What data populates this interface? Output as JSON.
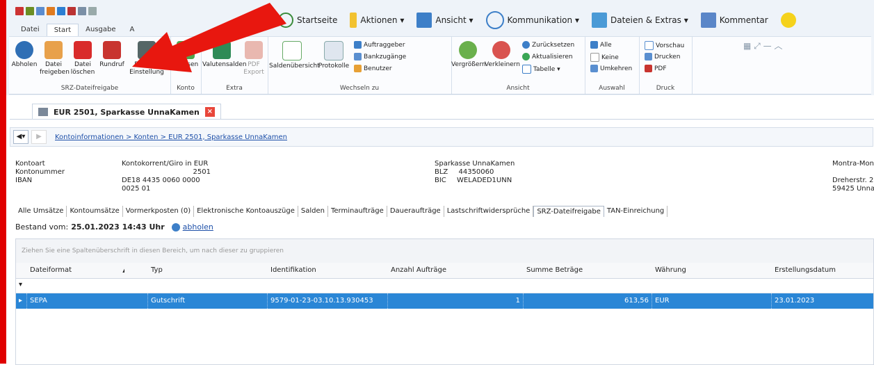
{
  "ribbon": {
    "tabs": [
      "Datei",
      "Start",
      "Ausgabe",
      "A"
    ],
    "topnav": [
      {
        "label": "Startseite",
        "icon": "home-icon"
      },
      {
        "label": "Aktionen ▾",
        "icon": "lightning-icon"
      },
      {
        "label": "Ansicht ▾",
        "icon": "view-icon"
      },
      {
        "label": "Kommunikation ▾",
        "icon": "phone-icon"
      },
      {
        "label": "Dateien & Extras ▾",
        "icon": "folder-icon"
      },
      {
        "label": "Kommentar",
        "icon": "comment-icon"
      }
    ],
    "groups": {
      "srz": {
        "label": "SRZ-Dateifreigabe",
        "abholen": "Abholen",
        "freigeben": "Datei freigeben",
        "loeschen": "Datei löschen",
        "rundruf": "Rundruf",
        "einstellung": "Rundruf Einstellung"
      },
      "konto": {
        "label": "Konto",
        "gelesen": "Gelesen"
      },
      "extra": {
        "label": "Extra",
        "valutensalden": "Valutensalden",
        "pdf_export": "PDF Export"
      },
      "wechseln": {
        "label": "Wechseln zu",
        "saldenuebersicht": "Saldenübersicht",
        "protokolle": "Protokolle",
        "auftraggeber": "Auftraggeber",
        "bankzugaenge": "Bankzugänge",
        "benutzer": "Benutzer"
      },
      "ansicht": {
        "label": "Ansicht",
        "vergroessern": "Vergrößern",
        "verkleinern": "Verkleinern",
        "zuruecksetzen": "Zurücksetzen",
        "aktualisieren": "Aktualisieren",
        "tabelle": "Tabelle ▾"
      },
      "auswahl": {
        "label": "Auswahl",
        "alle": "Alle",
        "keine": "Keine",
        "umkehren": "Umkehren"
      },
      "druck": {
        "label": "Druck",
        "vorschau": "Vorschau",
        "drucken": "Drucken",
        "pdf": "PDF"
      }
    }
  },
  "document": {
    "tab_title": "EUR 2501, Sparkasse UnnaKamen",
    "breadcrumb": "Kontoinformationen > Konten > EUR 2501, Sparkasse UnnaKamen"
  },
  "account": {
    "labels": {
      "kontoart": "Kontoart",
      "kontonummer": "Kontonummer",
      "iban": "IBAN",
      "blz": "BLZ",
      "bic": "BIC"
    },
    "kontoart": "Kontokorrent/Giro in EUR",
    "kontonummer": "2501",
    "iban": "DE18 4435 0060 0000 0025 01",
    "bank": "Sparkasse UnnaKamen",
    "blz": "44350060",
    "bic": "WELADED1UNN",
    "owner": "Montra-Mont",
    "street": "Dreherstr. 2",
    "city": "59425 Unna"
  },
  "subtabs": [
    "Alle Umsätze",
    "Kontoumsätze",
    "Vormerkposten (0)",
    "Elektronische Kontoauszüge",
    "Salden",
    "Terminaufträge",
    "Daueraufträge",
    "Lastschriftwidersprüche",
    "SRZ-Dateifreigabe",
    "TAN-Einreichung"
  ],
  "bestand": {
    "label": "Bestand vom:",
    "value": "25.01.2023 14:43 Uhr",
    "link": "abholen"
  },
  "grid": {
    "group_hint": "Ziehen Sie eine Spaltenüberschrift in diesen Bereich, um nach dieser zu gruppieren",
    "columns": [
      "Dateiformat",
      "Typ",
      "Identifikation",
      "Anzahl Aufträge",
      "Summe Beträge",
      "Währung",
      "Erstellungsdatum"
    ],
    "sort_marker": "▲",
    "rows": [
      {
        "dateiformat": "SEPA",
        "typ": "Gutschrift",
        "identifikation": "9579-01-23-03.10.13.930453",
        "anzahl": "1",
        "summe": "613,56",
        "waehrung": "EUR",
        "datum": "23.01.2023"
      }
    ]
  },
  "colors": {
    "annotation_red": "#e00000",
    "selection_blue": "#2a86d6",
    "link_blue": "#1d4fa8"
  }
}
